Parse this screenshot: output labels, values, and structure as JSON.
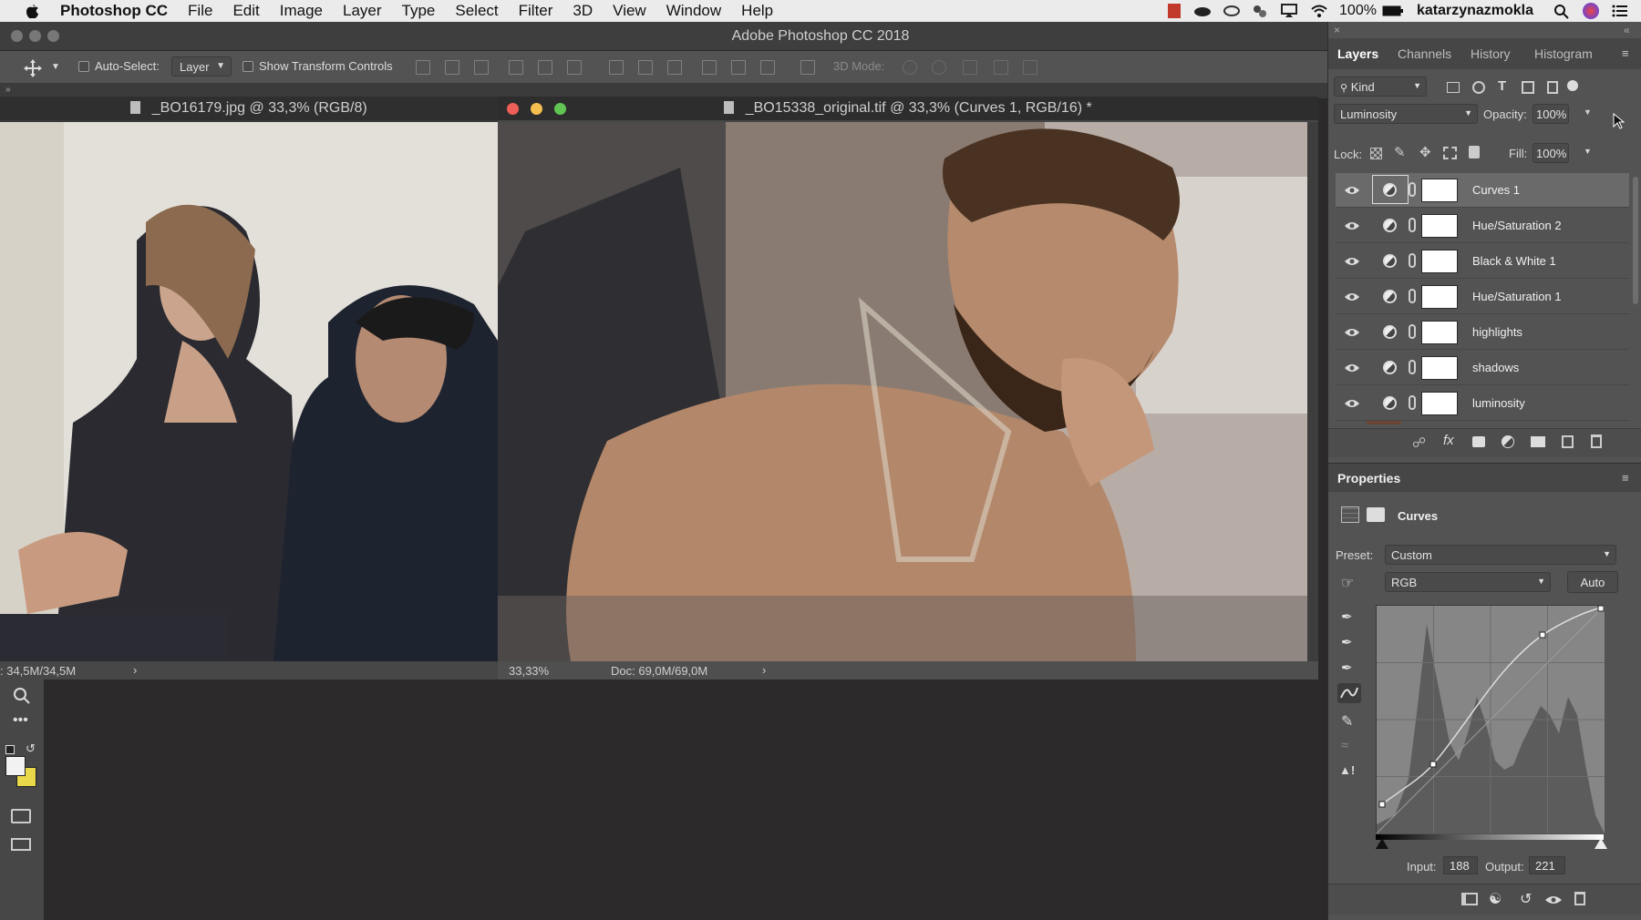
{
  "menubar": {
    "app_name": "Photoshop CC",
    "items": [
      "File",
      "Edit",
      "Image",
      "Layer",
      "Type",
      "Select",
      "Filter",
      "3D",
      "View",
      "Window",
      "Help"
    ],
    "battery": "100%",
    "username": "katarzynazmokla"
  },
  "app_title": "Adobe Photoshop CC 2018",
  "options": {
    "auto_select_label": "Auto-Select:",
    "auto_select_value": "Layer",
    "show_transform_label": "Show Transform Controls",
    "mode_3d_label": "3D Mode:"
  },
  "doc1": {
    "title": "_BO16179.jpg @ 33,3% (RGB/8)",
    "status": ": 34,5M/34,5M"
  },
  "doc2": {
    "title": "_BO15338_original.tif @ 33,3% (Curves 1, RGB/16) *",
    "zoom": "33,33%",
    "doc_size": "Doc: 69,0M/69,0M"
  },
  "layers_panel": {
    "tabs": [
      "Layers",
      "Channels",
      "History",
      "Histogram"
    ],
    "filter_kind": "Kind",
    "blend_mode": "Luminosity",
    "opacity_label": "Opacity:",
    "opacity_value": "100%",
    "lock_label": "Lock:",
    "fill_label": "Fill:",
    "fill_value": "100%",
    "layers": [
      {
        "name": "Curves 1",
        "selected": true
      },
      {
        "name": "Hue/Saturation 2",
        "selected": false
      },
      {
        "name": "Black & White 1",
        "selected": false
      },
      {
        "name": "Hue/Saturation 1",
        "selected": false
      },
      {
        "name": "highlights",
        "selected": false
      },
      {
        "name": "shadows",
        "selected": false
      },
      {
        "name": "luminosity",
        "selected": false
      }
    ]
  },
  "properties": {
    "title": "Properties",
    "adjustment": "Curves",
    "preset_label": "Preset:",
    "preset_value": "Custom",
    "channel_value": "RGB",
    "auto_label": "Auto",
    "input_label": "Input:",
    "input_value": "188",
    "output_label": "Output:",
    "output_value": "221"
  },
  "colors": {
    "accent_selected": "#6a6a6a",
    "panel_bg": "#535353",
    "background_swatch": "#e8d84a"
  }
}
